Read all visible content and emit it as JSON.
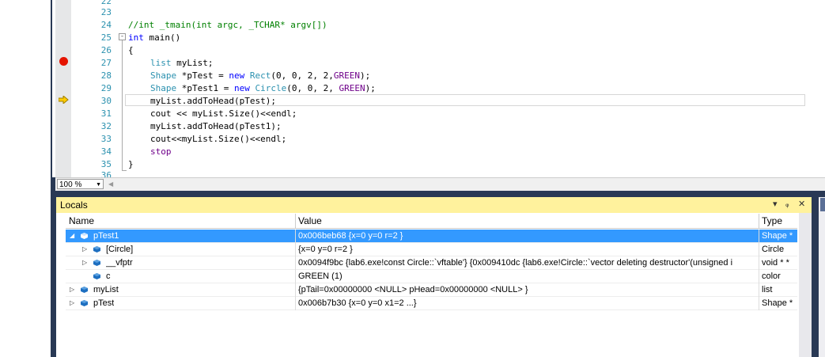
{
  "editor": {
    "lines": [
      {
        "num": "22",
        "code": ""
      },
      {
        "num": "23",
        "code": ""
      },
      {
        "num": "24",
        "code": "//int _tmain(int argc, _TCHAR* argv[])"
      },
      {
        "num": "25",
        "code": "int main()"
      },
      {
        "num": "26",
        "code": "{"
      },
      {
        "num": "27",
        "code": "list myList;"
      },
      {
        "num": "28",
        "code": "Shape *pTest = new Rect(0, 0, 2, 2,GREEN);"
      },
      {
        "num": "29",
        "code": "Shape *pTest1 = new Circle(0, 0, 2, GREEN);"
      },
      {
        "num": "30",
        "code": "myList.addToHead(pTest);"
      },
      {
        "num": "31",
        "code": "cout << myList.Size()<<endl;"
      },
      {
        "num": "32",
        "code": "myList.addToHead(pTest1);"
      },
      {
        "num": "33",
        "code": "cout<<myList.Size()<<endl;"
      },
      {
        "num": "34",
        "code": "stop"
      },
      {
        "num": "35",
        "code": "}"
      },
      {
        "num": "36",
        "code": ""
      }
    ],
    "breakpoint_line": "27",
    "current_line": "30",
    "collapse_glyph": "-"
  },
  "zoom": {
    "value": "100 %"
  },
  "locals": {
    "title": "Locals",
    "title_buttons": {
      "dropdown": "▾",
      "pin": "ᵩ",
      "close": "✕"
    },
    "columns": {
      "name": "Name",
      "value": "Value",
      "type": "Type"
    },
    "rows": [
      {
        "expander": "◢",
        "name": "pTest1",
        "value": "0x006beb68 {x=0 y=0 r=2 }",
        "type": "Shape *",
        "indent": 0,
        "selected": true,
        "icon": "object-icon"
      },
      {
        "expander": "▷",
        "name": "[Circle]",
        "value": "{x=0 y=0 r=2 }",
        "type": "Circle",
        "indent": 1,
        "selected": false,
        "icon": "field-icon"
      },
      {
        "expander": "▷",
        "name": "__vfptr",
        "value": "0x0094f9bc {lab6.exe!const Circle::`vftable'} {0x009410dc {lab6.exe!Circle::`vector deleting destructor'(unsigned i",
        "type": "void * *",
        "indent": 1,
        "selected": false,
        "icon": "field-icon"
      },
      {
        "expander": "",
        "name": "c",
        "value": "GREEN (1)",
        "type": "color",
        "indent": 1,
        "selected": false,
        "icon": "enum-field-icon"
      },
      {
        "expander": "▷",
        "name": "myList",
        "value": "{pTail=0x00000000 <NULL> pHead=0x00000000 <NULL> }",
        "type": "list",
        "indent": 0,
        "selected": false,
        "icon": "field-icon"
      },
      {
        "expander": "▷",
        "name": "pTest",
        "value": "0x006b7b30 {x=0 y=0 x1=2 ...}",
        "type": "Shape *",
        "indent": 0,
        "selected": false,
        "icon": "field-icon"
      }
    ]
  },
  "colors": {
    "breakpoint": "#e51400",
    "instruction_pointer": "#ffcc00",
    "locals_title_bg": "#fff29d",
    "selection": "#3399ff",
    "vs_blue": "#293955"
  }
}
